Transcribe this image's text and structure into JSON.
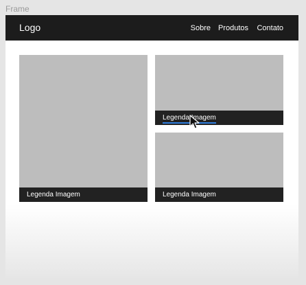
{
  "frame": {
    "label": "Frame"
  },
  "navbar": {
    "logo": "Logo",
    "links": [
      "Sobre",
      "Produtos",
      "Contato"
    ]
  },
  "gallery": {
    "cards": [
      {
        "caption": "Legenda Imagem"
      },
      {
        "caption": "Legenda Imagem"
      },
      {
        "caption": "Legenda Imagem"
      }
    ]
  },
  "colors": {
    "navbar_bg": "#1c1c1c",
    "placeholder": "#bdbdbd",
    "caption_bg": "#222222",
    "selection_underline": "#2f7fe0"
  },
  "icons": {
    "cursor": "mouse-pointer-icon"
  }
}
